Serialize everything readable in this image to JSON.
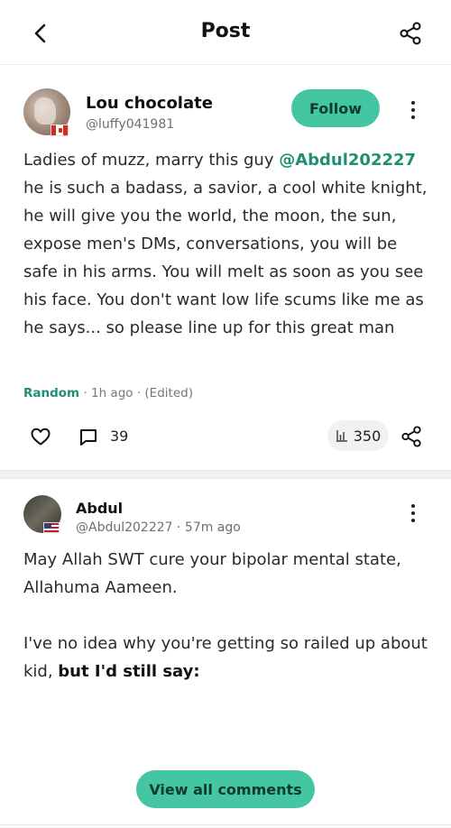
{
  "header": {
    "title": "Post",
    "back_icon": "chevron-left-icon",
    "share_icon": "share-icon"
  },
  "post": {
    "author_name": "Lou chocolate",
    "author_handle": "@luffy041981",
    "follow_label": "Follow",
    "body_prefix": "Ladies of muzz, marry this guy ",
    "mention": "@Abdul202227",
    "body_suffix": " he is such a badass, a savior, a cool white knight, he will give you the world, the moon, the sun, expose men's DMs, conversations, you will be safe in his arms. You will melt as soon as you see his face. You don't want low life scums like me as he says... so please line up for this great man",
    "category": "Random",
    "meta_rest": " · 1h ago · (Edited)",
    "comment_count": "39",
    "view_count": "350"
  },
  "comment": {
    "author_name": "Abdul",
    "handle_time": "@Abdul202227 · 57m ago",
    "paragraph1": "May Allah SWT cure your bipolar mental state, Allahuma Aameen.",
    "paragraph2_plain": "I've no idea why you're getting so railed up about kid, ",
    "paragraph2_bold": "but I'd still say:"
  },
  "footer": {
    "view_all_label": "View all comments"
  },
  "colors": {
    "accent": "#45c6a3",
    "mention": "#1f8f74"
  }
}
